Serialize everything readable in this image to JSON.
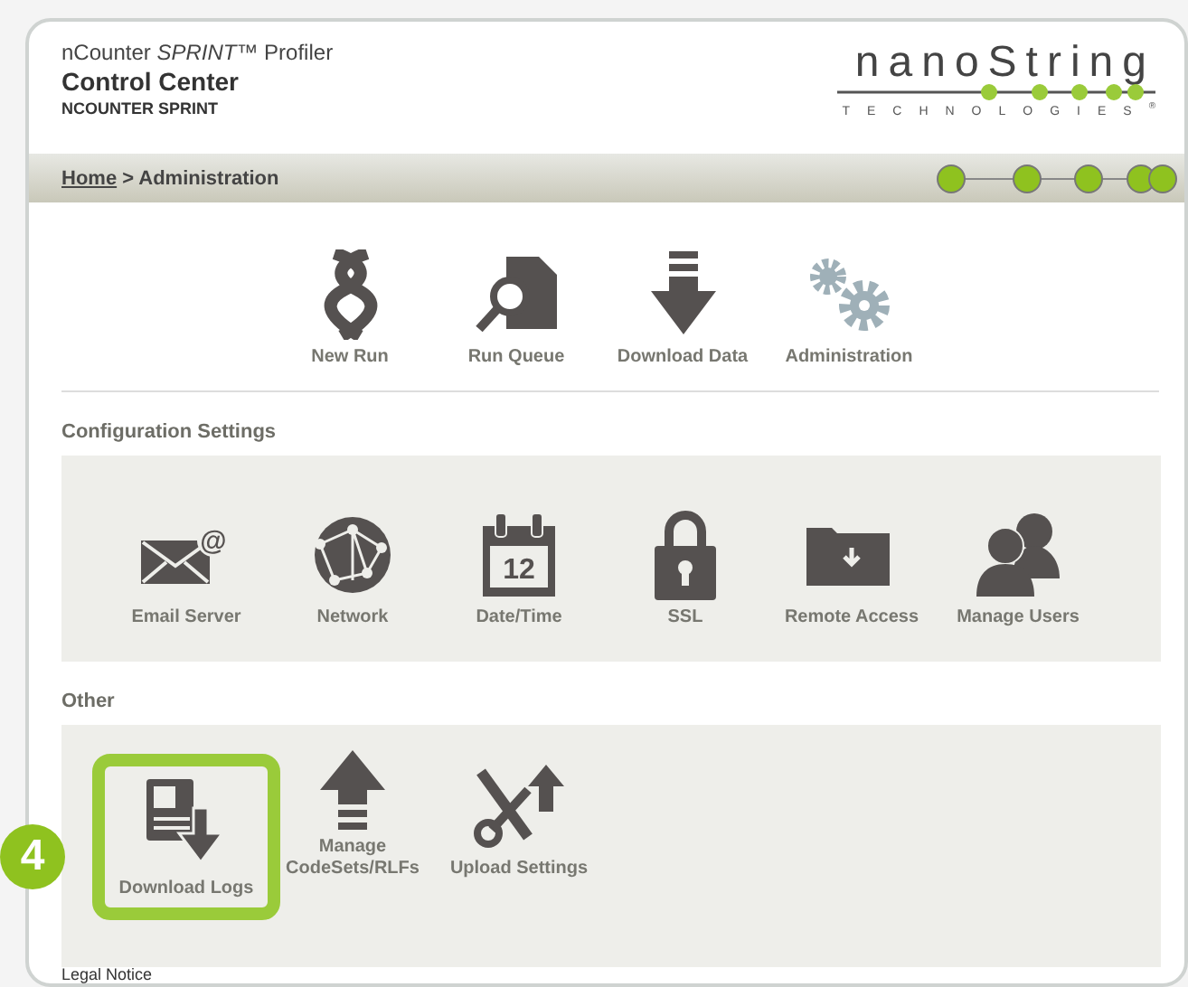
{
  "header": {
    "product_prefix": "nCounter ",
    "product_italic": "SPRINT",
    "product_suffix": "™ Profiler",
    "title": "Control Center",
    "subtitle": "NCOUNTER SPRINT"
  },
  "logo": {
    "wordmark": "nanoString",
    "tagline": "TECHNOLOGIES",
    "mark": "®"
  },
  "breadcrumb": {
    "home": "Home",
    "separator": ">",
    "current": "Administration"
  },
  "top_nav": [
    {
      "kind": "dna",
      "label": "New Run"
    },
    {
      "kind": "search-doc",
      "label": "Run Queue"
    },
    {
      "kind": "download",
      "label": "Download Data"
    },
    {
      "kind": "gears",
      "label": "Administration"
    }
  ],
  "sections": [
    {
      "title": "Configuration Settings",
      "items": [
        {
          "kind": "mail",
          "label": "Email Server",
          "glyph": "@",
          "highlighted": false
        },
        {
          "kind": "globe",
          "label": "Network",
          "highlighted": false
        },
        {
          "kind": "calendar",
          "label": "Date/Time",
          "day": "12",
          "highlighted": false
        },
        {
          "kind": "lock",
          "label": "SSL",
          "highlighted": false
        },
        {
          "kind": "folder",
          "label": "Remote Access",
          "highlighted": false
        },
        {
          "kind": "users",
          "label": "Manage Users",
          "highlighted": false
        }
      ]
    },
    {
      "title": "Other",
      "items": [
        {
          "kind": "logs",
          "label": "Download Logs",
          "highlighted": true
        },
        {
          "kind": "upload",
          "label": "Manage CodeSets/RLFs",
          "highlighted": false
        },
        {
          "kind": "tools",
          "label": "Upload Settings",
          "highlighted": false
        }
      ]
    }
  ],
  "step_badge": "4",
  "footer": {
    "link": "Legal Notice"
  }
}
